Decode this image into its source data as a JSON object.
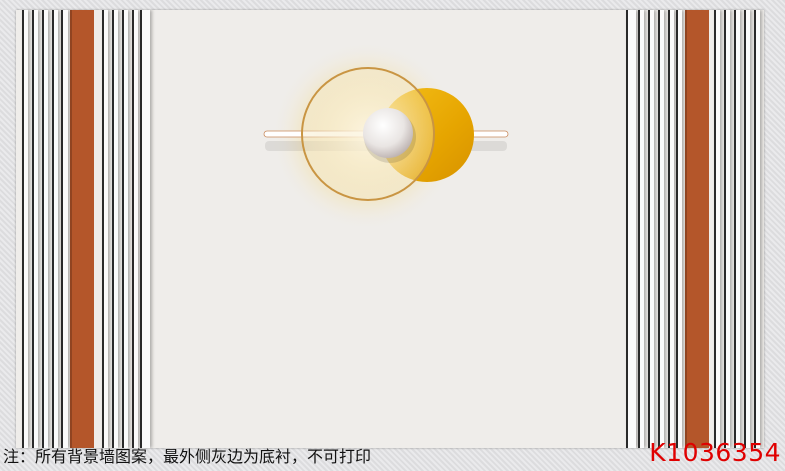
{
  "footer": {
    "note": "注：所有背景墙图案，最外侧灰边为底衬，不可打印",
    "product_code": "K1036354"
  },
  "colors": {
    "accent_orange": "#b4562a",
    "gold": "#e8a800",
    "background": "#efedea"
  },
  "design": {
    "motif": "stripes-with-gold-circles",
    "icon": "sun-moon-circle-icon"
  }
}
